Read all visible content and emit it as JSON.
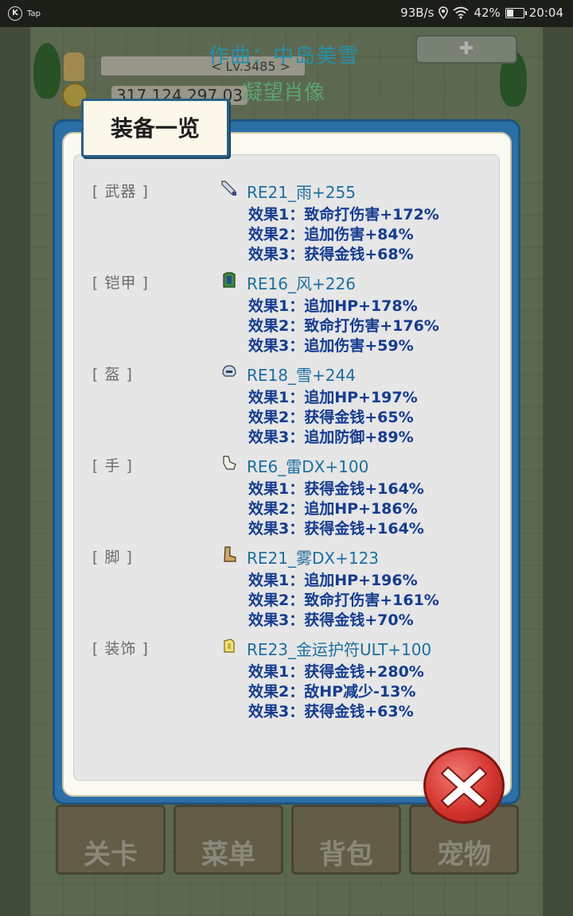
{
  "status_bar": {
    "app_icon": "K",
    "app_label": "Tap",
    "net_speed": "93B/s",
    "battery": "42%",
    "time": "20:04",
    "icons": [
      "location-icon",
      "wifi-icon",
      "battery-icon"
    ]
  },
  "background": {
    "composer_line": "作曲：中岛美雪",
    "song_title": "凝望肖像",
    "level_text": "< Lv.3485 >",
    "gold_text": "317,124,297,03",
    "nav": [
      "关卡",
      "菜单",
      "背包",
      "宠物"
    ]
  },
  "panel": {
    "title": "装备一览",
    "slots": [
      {
        "label": "[ 武器 ]",
        "icon": "sword-icon",
        "name": "RE21_雨+255",
        "effects": [
          "效果1：致命打伤害+172%",
          "效果2：追加伤害+84%",
          "效果3：获得金钱+68%"
        ]
      },
      {
        "label": "[ 铠甲 ]",
        "icon": "armor-icon",
        "name": "RE16_风+226",
        "effects": [
          "效果1：追加HP+178%",
          "效果2：致命打伤害+176%",
          "效果3：追加伤害+59%"
        ]
      },
      {
        "label": "[ 盔 ]",
        "icon": "helmet-icon",
        "name": "RE18_雪+244",
        "effects": [
          "效果1：追加HP+197%",
          "效果2：获得金钱+65%",
          "效果3：追加防御+89%"
        ]
      },
      {
        "label": "[ 手 ]",
        "icon": "glove-icon",
        "name": "RE6_雷DX+100",
        "effects": [
          "效果1：获得金钱+164%",
          "效果2：追加HP+186%",
          "效果3：获得金钱+164%"
        ]
      },
      {
        "label": "[ 脚 ]",
        "icon": "boot-icon",
        "name": "RE21_雾DX+123",
        "effects": [
          "效果1：追加HP+196%",
          "效果2：致命打伤害+161%",
          "效果3：获得金钱+70%"
        ]
      },
      {
        "label": "[ 装饰 ]",
        "icon": "amulet-icon",
        "name": "RE23_金运护符ULT+100",
        "effects": [
          "效果1：获得金钱+280%",
          "效果2：敌HP减少-13%",
          "效果3：获得金钱+63%"
        ]
      }
    ],
    "close": "close-icon"
  }
}
